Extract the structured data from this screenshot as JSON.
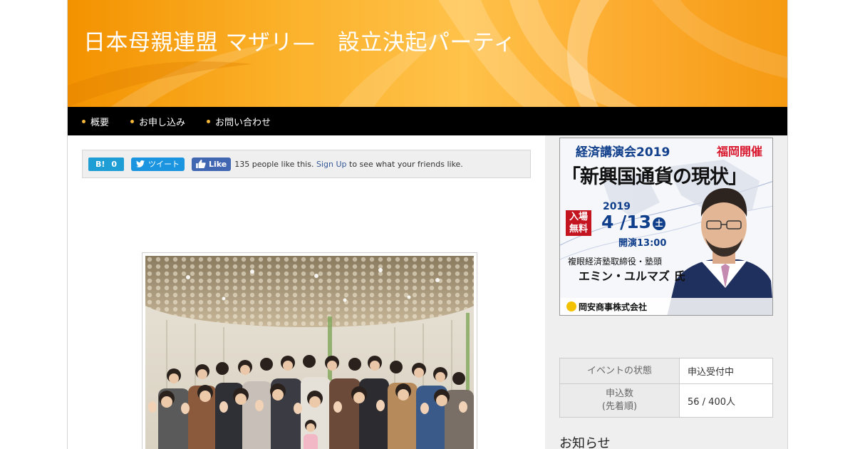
{
  "site": {
    "title": "日本母親連盟 マザリ—　設立決起パーティ",
    "header_colors": {
      "primary": "#f39200",
      "light": "#ffc24a"
    }
  },
  "nav": {
    "items": [
      {
        "label": "概要"
      },
      {
        "label": "お申し込み"
      },
      {
        "label": "お問い合わせ"
      }
    ]
  },
  "share": {
    "hatena_count": "0",
    "tweet_label": "ツイート",
    "like_label": "Like",
    "fb_text_before": "135 people like this.",
    "fb_signup": "Sign Up",
    "fb_text_after": "to see what your friends like."
  },
  "banner": {
    "lecture": "経済講演会2019",
    "location": "福岡開催",
    "title": "「新興国通貨の現状」",
    "free_line1": "入場",
    "free_line2": "無料",
    "year": "2019",
    "date": "4 /13",
    "weekday": "土",
    "start": "開演13:00",
    "role": "複眼経済塾取締役・塾頭",
    "speaker": "エミン・ユルマズ 氏",
    "company": "岡安商事株式会社"
  },
  "event_info": {
    "status_label": "イベントの状態",
    "status_value": "申込受付中",
    "count_label_line1": "申込数",
    "count_label_line2": "(先着順)",
    "count_value": "56 / 400人"
  },
  "news": {
    "heading": "お知らせ"
  }
}
